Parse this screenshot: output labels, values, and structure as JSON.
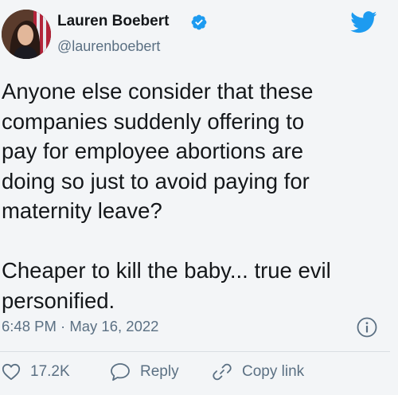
{
  "tweet": {
    "author_name": "Lauren Boebert",
    "handle": "@laurenboebert",
    "verified": true,
    "text": "Anyone else consider that these\ncompanies suddenly offering to\npay for employee abortions are\ndoing so just to avoid paying for\nmaternity leave?\n\nCheaper to kill the baby... true evil\npersonified.",
    "timestamp": "6:48 PM · May 16, 2022",
    "like_count": "17.2K",
    "reply_label": "Reply",
    "copy_link_label": "Copy link"
  },
  "icons": {
    "verified": "verified-badge-icon",
    "brand": "twitter-bird-icon",
    "info": "info-icon",
    "like": "heart-icon",
    "reply": "speech-bubble-icon",
    "copy_link": "link-icon"
  },
  "colors": {
    "brand_blue": "#1d9bf0",
    "text_primary": "#14171a",
    "text_secondary": "#5b7083",
    "background": "#f3f5f7"
  }
}
